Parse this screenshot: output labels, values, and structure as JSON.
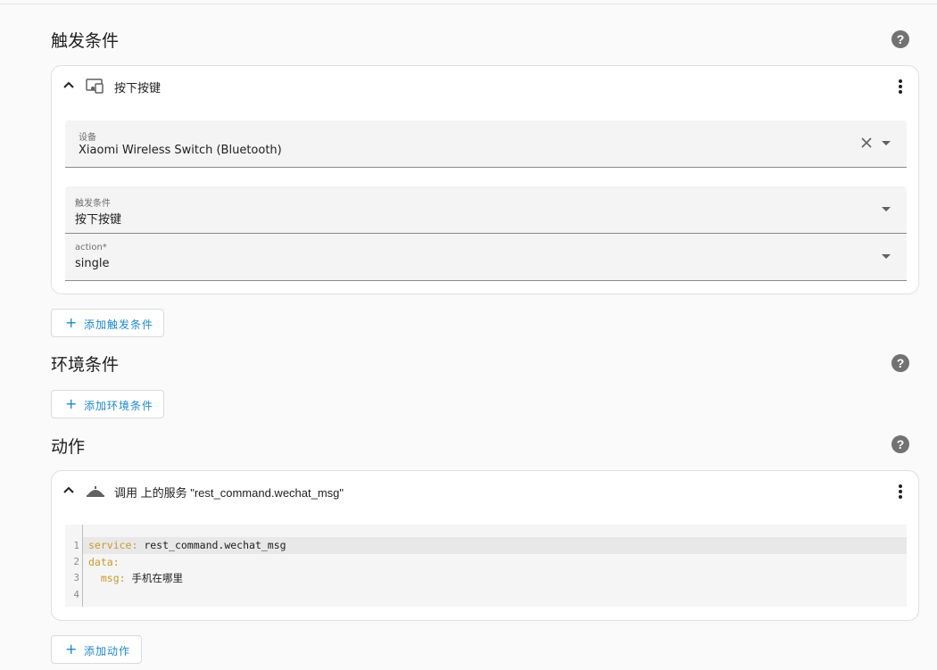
{
  "sections": {
    "triggers": {
      "title": "触发条件",
      "add_label": "添加触发条件"
    },
    "conditions": {
      "title": "环境条件",
      "add_label": "添加环境条件"
    },
    "actions": {
      "title": "动作",
      "add_label": "添加动作"
    }
  },
  "trigger_card": {
    "title": "按下按键",
    "icon": "device-icon",
    "device_field": {
      "label": "设备",
      "value": "Xiaomi Wireless Switch (Bluetooth)"
    },
    "trigger_field": {
      "label": "触发条件",
      "value": "按下按键"
    },
    "action_field": {
      "label": "action*",
      "value": "single"
    }
  },
  "action_card": {
    "title": "调用 上的服务 \"rest_command.wechat_msg\"",
    "icon": "service-bell-icon",
    "code_lines": [
      {
        "n": "1",
        "key": "service",
        "sep": ": ",
        "val": "rest_command.wechat_msg",
        "indent": ""
      },
      {
        "n": "2",
        "key": "data",
        "sep": ":",
        "val": "",
        "indent": ""
      },
      {
        "n": "3",
        "key": "msg",
        "sep": ": ",
        "val": "手机在哪里",
        "indent": "  "
      },
      {
        "n": "4",
        "key": "",
        "sep": "",
        "val": "",
        "indent": ""
      }
    ]
  },
  "help_icon": "?",
  "colors": {
    "accent": "#1e88c9",
    "yaml_key": "#c99a2e",
    "help_bg": "#727272"
  }
}
